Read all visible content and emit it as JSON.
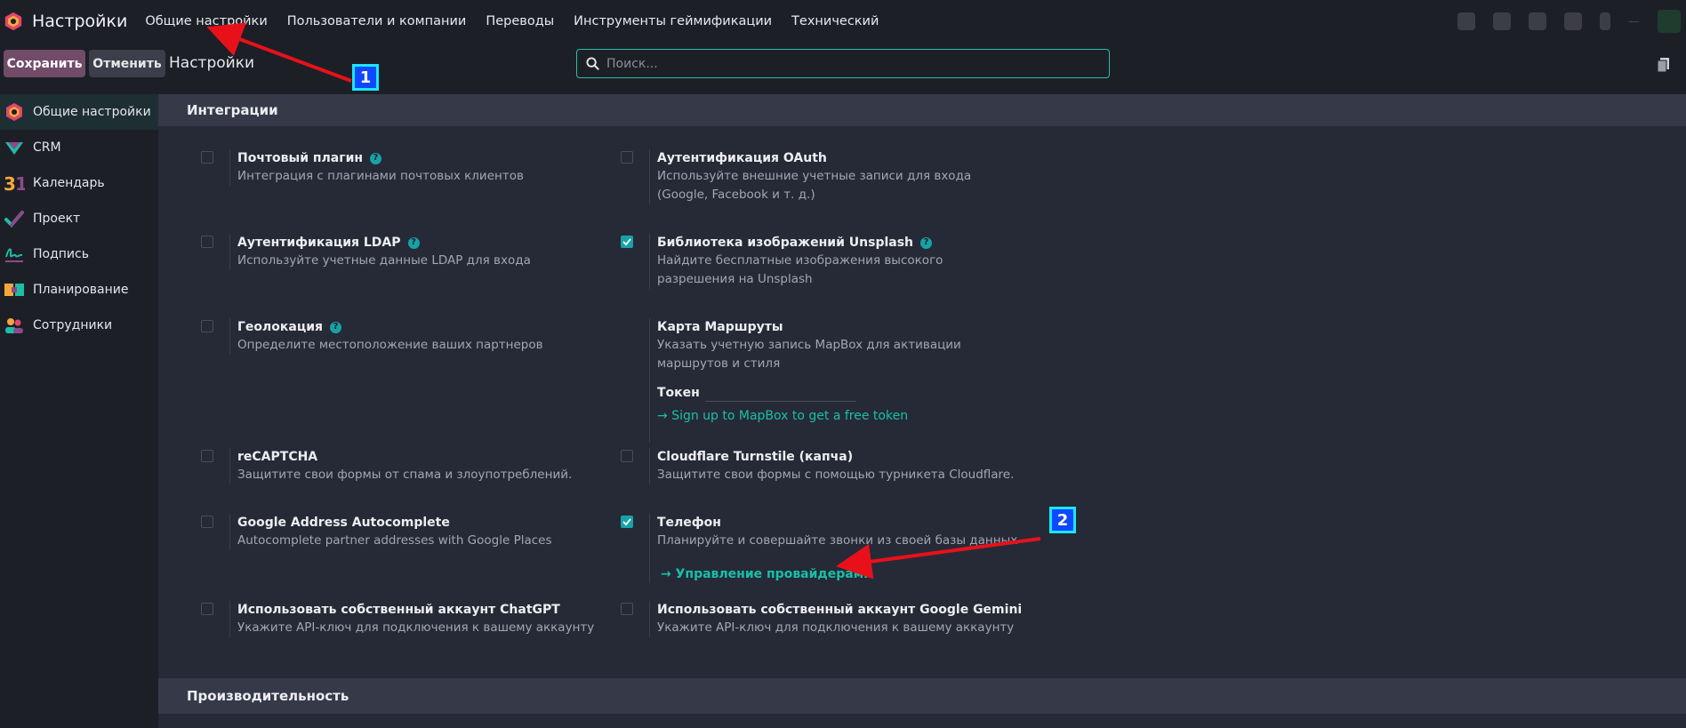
{
  "navbar": {
    "app_title": "Настройки",
    "menu": [
      "Общие настройки",
      "Пользователи и компании",
      "Переводы",
      "Инструменты геймификации",
      "Технический"
    ]
  },
  "control": {
    "save_label": "Сохранить",
    "cancel_label": "Отменить",
    "breadcrumb": "Настройки",
    "search_placeholder": "Поиск..."
  },
  "sidebar": {
    "items": [
      {
        "label": "Общие настройки",
        "icon": "settings-app-icon"
      },
      {
        "label": "CRM",
        "icon": "crm-app-icon"
      },
      {
        "label": "Календарь",
        "icon": "calendar-app-icon"
      },
      {
        "label": "Проект",
        "icon": "project-app-icon"
      },
      {
        "label": "Подпись",
        "icon": "sign-app-icon"
      },
      {
        "label": "Планирование",
        "icon": "planning-app-icon"
      },
      {
        "label": "Сотрудники",
        "icon": "employees-app-icon"
      }
    ]
  },
  "sections": {
    "integrations": "Интеграции",
    "performance": "Производительность"
  },
  "settings": {
    "mail_plugin": {
      "title": "Почтовый плагин",
      "desc": "Интеграция с плагинами почтовых клиентов",
      "checked": false
    },
    "oauth": {
      "title": "Аутентификация OAuth",
      "desc": "Используйте внешние учетные записи для входа (Google, Facebook и т. д.)",
      "checked": false
    },
    "ldap": {
      "title": "Аутентификация LDAP",
      "desc": "Используйте учетные данные LDAP для входа",
      "checked": false
    },
    "unsplash": {
      "title": "Библиотека изображений Unsplash",
      "desc": "Найдите бесплатные изображения высокого разрешения на Unsplash",
      "checked": true
    },
    "geolocation": {
      "title": "Геолокация",
      "desc": "Определите местоположение ваших партнеров",
      "checked": false
    },
    "map_routes": {
      "title": "Карта Маршруты",
      "desc": "Указать учетную запись MapBox для активации маршрутов и стиля",
      "token_label": "Токен",
      "link": "Sign up to MapBox to get a free token"
    },
    "recaptcha": {
      "title": "reCAPTCHA",
      "desc": "Защитите свои формы от спама и злоупотреблений.",
      "checked": false
    },
    "cloudflare": {
      "title": "Cloudflare Turnstile (капча)",
      "desc": "Защитите свои формы с помощью турникета Cloudflare.",
      "checked": false
    },
    "google_address": {
      "title": "Google Address Autocomplete",
      "desc": "Autocomplete partner addresses with Google Places",
      "checked": false
    },
    "phone": {
      "title": "Телефон",
      "desc": "Планируйте и совершайте звонки из своей базы данных",
      "link": "Управление провайдерами",
      "checked": true
    },
    "chatgpt": {
      "title": "Использовать собственный аккаунт ChatGPT",
      "desc": "Укажите API-ключ для подключения к вашему аккаунту",
      "checked": false
    },
    "gemini": {
      "title": "Использовать собственный аккаунт Google Gemini",
      "desc": "Укажите API-ключ для подключения к вашему аккаунту",
      "checked": false
    }
  },
  "annotations": {
    "marker_1": "1",
    "marker_2": "2",
    "arrow_color": "#e8111a"
  },
  "colors": {
    "accent": "#17a2a6",
    "primary_button": "#714b67",
    "link": "#17c0a8"
  }
}
